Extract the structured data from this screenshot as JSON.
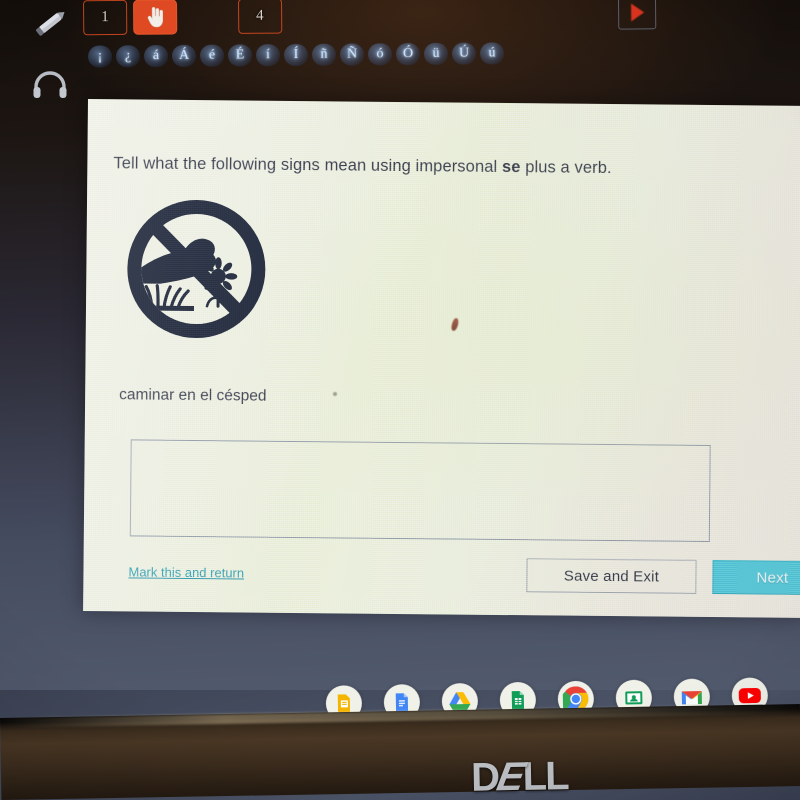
{
  "toolbar": {
    "pencil_icon": "pencil-icon",
    "num_tab_1": "1",
    "hand_tool_glyph": "☝",
    "num_tab_4": "4",
    "play_icon": "play-icon",
    "headphones_icon": "headphones-icon",
    "accent_keys": [
      "¡",
      "¿",
      "á",
      "Á",
      "é",
      "É",
      "í",
      "Í",
      "ñ",
      "Ñ",
      "ó",
      "Ó",
      "ü",
      "Ú",
      "ú"
    ]
  },
  "page": {
    "prompt_before": "Tell what the following signs mean using impersonal ",
    "prompt_bold": "se",
    "prompt_after": " plus a verb.",
    "sign_icon": "no-walking-on-grass-sign",
    "caption": "caminar en el césped",
    "answer_value": "",
    "answer_placeholder": "",
    "mark_link": "Mark this and return",
    "save_exit_label": "Save and Exit",
    "next_label": "Next"
  },
  "shelf": {
    "icons": [
      {
        "name": "google-keep-icon",
        "color": "#f5b400"
      },
      {
        "name": "google-docs-icon",
        "color": "#4285f4"
      },
      {
        "name": "google-drive-icon",
        "color": "#34a853"
      },
      {
        "name": "google-sheets-icon",
        "color": "#0f9d58"
      },
      {
        "name": "google-chrome-icon",
        "color": "#4285f4"
      },
      {
        "name": "google-classroom-icon",
        "color": "#0f9d58"
      },
      {
        "name": "gmail-icon",
        "color": "#ea4335"
      },
      {
        "name": "youtube-icon",
        "color": "#ff0000"
      }
    ]
  },
  "device": {
    "brand": "DELL",
    "brand_part1": "D",
    "brand_part2": "E",
    "brand_part3": "L",
    "brand_part4": "L"
  },
  "colors": {
    "accent_teal": "#4fc3d8",
    "link_teal": "#2a8fa8",
    "toolbar_orange": "#e04a23",
    "page_bg": "#eaeddd"
  }
}
